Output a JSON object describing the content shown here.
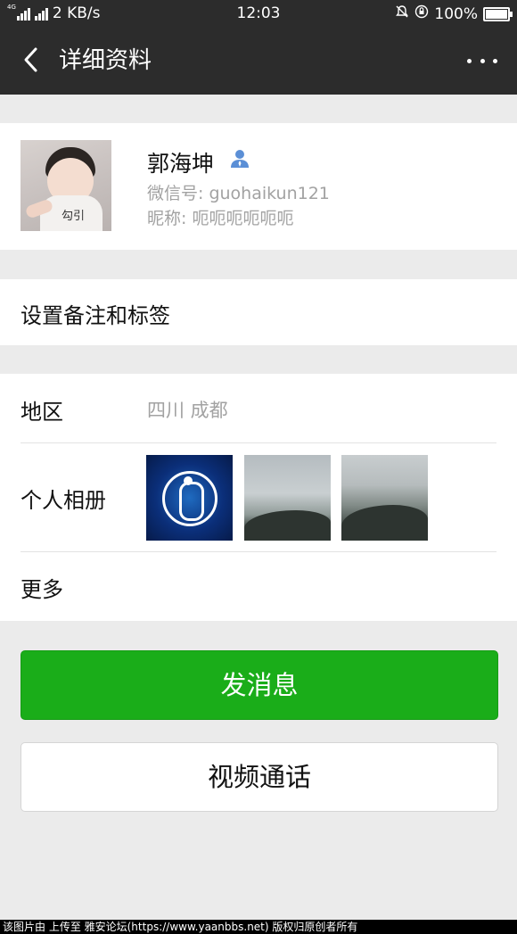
{
  "status_bar": {
    "network": "4G",
    "speed": "2 KB/s",
    "time": "12:03",
    "battery": "100%"
  },
  "nav": {
    "title": "详细资料"
  },
  "profile": {
    "name": "郭海坤",
    "wechat_id": "微信号: guohaikun121",
    "nickname": "昵称: 呃呃呃呃呃呃",
    "avatar_text": "勾引"
  },
  "remark": {
    "label": "设置备注和标签"
  },
  "info": {
    "region_label": "地区",
    "region_value": "四川  成都",
    "album_label": "个人相册",
    "more_label": "更多"
  },
  "actions": {
    "message": "发消息",
    "video_call": "视频通话"
  },
  "footer": {
    "text": "该图片由 上传至 雅安论坛(https://www.yaanbbs.net) 版权归原创者所有"
  },
  "colors": {
    "header": "#2c2c2c",
    "primary_button": "#1aad19",
    "background": "#ebebeb"
  }
}
